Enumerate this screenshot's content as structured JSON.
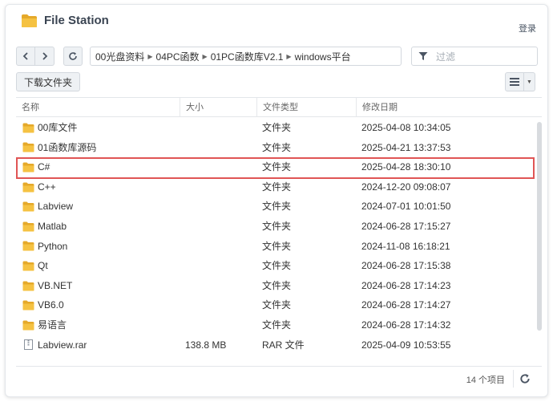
{
  "app": {
    "title": "File Station",
    "login": "登录"
  },
  "breadcrumb": [
    "00光盘资料",
    "04PC函数",
    "01PC函数库V2.1",
    "windows平台"
  ],
  "filter": {
    "placeholder": "过滤"
  },
  "actions": {
    "download": "下载文件夹"
  },
  "columns": {
    "name": "名称",
    "size": "大小",
    "type": "文件类型",
    "modified": "修改日期"
  },
  "files": [
    {
      "name": "00库文件",
      "size": "",
      "type": "文件夹",
      "modified": "2025-04-08 10:34:05",
      "kind": "folder"
    },
    {
      "name": "01函数库源码",
      "size": "",
      "type": "文件夹",
      "modified": "2025-04-21 13:37:53",
      "kind": "folder"
    },
    {
      "name": "C#",
      "size": "",
      "type": "文件夹",
      "modified": "2025-04-28 18:30:10",
      "kind": "folder",
      "highlighted": true
    },
    {
      "name": "C++",
      "size": "",
      "type": "文件夹",
      "modified": "2024-12-20 09:08:07",
      "kind": "folder"
    },
    {
      "name": "Labview",
      "size": "",
      "type": "文件夹",
      "modified": "2024-07-01 10:01:50",
      "kind": "folder"
    },
    {
      "name": "Matlab",
      "size": "",
      "type": "文件夹",
      "modified": "2024-06-28 17:15:27",
      "kind": "folder"
    },
    {
      "name": "Python",
      "size": "",
      "type": "文件夹",
      "modified": "2024-11-08 16:18:21",
      "kind": "folder"
    },
    {
      "name": "Qt",
      "size": "",
      "type": "文件夹",
      "modified": "2024-06-28 17:15:38",
      "kind": "folder"
    },
    {
      "name": "VB.NET",
      "size": "",
      "type": "文件夹",
      "modified": "2024-06-28 17:14:23",
      "kind": "folder"
    },
    {
      "name": "VB6.0",
      "size": "",
      "type": "文件夹",
      "modified": "2024-06-28 17:14:27",
      "kind": "folder"
    },
    {
      "name": "易语言",
      "size": "",
      "type": "文件夹",
      "modified": "2024-06-28 17:14:32",
      "kind": "folder"
    },
    {
      "name": "Labview.rar",
      "size": "138.8 MB",
      "type": "RAR 文件",
      "modified": "2025-04-09 10:53:55",
      "kind": "file"
    }
  ],
  "footer": {
    "count": "14 个项目"
  },
  "colors": {
    "folder": "#f5c242",
    "folder_dark": "#e5a92a",
    "highlight_border": "#e05555"
  },
  "icons": {
    "app": "folder-icon",
    "back": "chevron-left-icon",
    "forward": "chevron-right-icon",
    "refresh": "refresh-icon",
    "filter": "filter-icon",
    "view": "list-view-icon",
    "dropdown": "caret-down-icon"
  }
}
